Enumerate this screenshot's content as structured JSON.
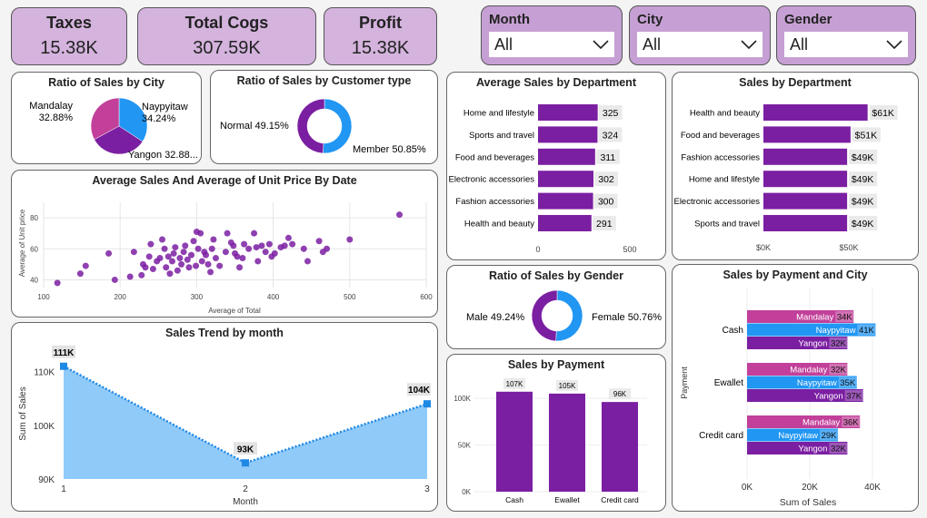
{
  "kpis": {
    "taxes": {
      "title": "Taxes",
      "value": "15.38K"
    },
    "cogs": {
      "title": "Total Cogs",
      "value": "307.59K"
    },
    "profit": {
      "title": "Profit",
      "value": "15.38K"
    }
  },
  "slicers": {
    "month": {
      "title": "Month",
      "value": "All"
    },
    "city": {
      "title": "City",
      "value": "All"
    },
    "gender": {
      "title": "Gender",
      "value": "All"
    }
  },
  "colors": {
    "purple": "#7b1fa2",
    "blue": "#2196f3",
    "pink": "#c2409a",
    "area": "#90caf9",
    "kpi": "#d4b3dd"
  },
  "chart_data": [
    {
      "id": "city_pie",
      "type": "pie",
      "title": "Ratio of Sales by City",
      "slices": [
        {
          "label": "Naypyitaw",
          "text": "34.24%",
          "value": 34.24,
          "color": "#2196f3"
        },
        {
          "label": "Yangon",
          "text": "32.88...",
          "value": 32.88,
          "color": "#7b1fa2"
        },
        {
          "label": "Mandalay",
          "text": "32.88%",
          "value": 32.88,
          "color": "#c2409a"
        }
      ]
    },
    {
      "id": "customer_donut",
      "type": "pie",
      "title": "Ratio of Sales by Customer type",
      "slices": [
        {
          "label": "Member",
          "text": "50.85%",
          "value": 50.85,
          "color": "#2196f3"
        },
        {
          "label": "Normal",
          "text": "49.15%",
          "value": 49.15,
          "color": "#7b1fa2"
        }
      ]
    },
    {
      "id": "scatter",
      "type": "scatter",
      "title": "Average Sales And Average of Unit Price By Date",
      "xlabel": "Average of Total",
      "ylabel": "Average of Unit price",
      "xlim": [
        100,
        600
      ],
      "ylim": [
        35,
        90
      ],
      "xticks": [
        100,
        200,
        300,
        400,
        500,
        600
      ],
      "yticks": [
        40,
        60,
        80
      ],
      "points": [
        [
          118,
          38
        ],
        [
          148,
          44
        ],
        [
          155,
          49
        ],
        [
          185,
          57
        ],
        [
          193,
          40
        ],
        [
          213,
          42
        ],
        [
          218,
          58
        ],
        [
          228,
          43
        ],
        [
          230,
          50
        ],
        [
          233,
          48
        ],
        [
          238,
          55
        ],
        [
          240,
          63
        ],
        [
          243,
          47
        ],
        [
          248,
          52
        ],
        [
          252,
          54
        ],
        [
          255,
          66
        ],
        [
          258,
          60
        ],
        [
          260,
          48
        ],
        [
          263,
          55
        ],
        [
          265,
          44
        ],
        [
          268,
          52
        ],
        [
          270,
          57
        ],
        [
          272,
          61
        ],
        [
          275,
          46
        ],
        [
          278,
          54
        ],
        [
          280,
          50
        ],
        [
          283,
          58
        ],
        [
          285,
          62
        ],
        [
          288,
          53
        ],
        [
          290,
          48
        ],
        [
          293,
          56
        ],
        [
          296,
          65
        ],
        [
          299,
          49
        ],
        [
          300,
          71
        ],
        [
          302,
          60
        ],
        [
          305,
          70
        ],
        [
          307,
          52
        ],
        [
          310,
          58
        ],
        [
          312,
          56
        ],
        [
          315,
          50
        ],
        [
          318,
          45
        ],
        [
          320,
          60
        ],
        [
          322,
          66
        ],
        [
          325,
          54
        ],
        [
          330,
          49
        ],
        [
          338,
          58
        ],
        [
          340,
          70
        ],
        [
          345,
          64
        ],
        [
          348,
          62
        ],
        [
          350,
          57
        ],
        [
          353,
          55
        ],
        [
          356,
          48
        ],
        [
          360,
          54
        ],
        [
          362,
          63
        ],
        [
          368,
          60
        ],
        [
          375,
          70
        ],
        [
          378,
          61
        ],
        [
          380,
          52
        ],
        [
          385,
          62
        ],
        [
          390,
          58
        ],
        [
          395,
          63
        ],
        [
          398,
          55
        ],
        [
          402,
          57
        ],
        [
          410,
          61
        ],
        [
          415,
          62
        ],
        [
          420,
          67
        ],
        [
          425,
          63
        ],
        [
          440,
          60
        ],
        [
          445,
          52
        ],
        [
          460,
          65
        ],
        [
          465,
          58
        ],
        [
          470,
          60
        ],
        [
          500,
          66
        ],
        [
          565,
          82
        ]
      ]
    },
    {
      "id": "trend",
      "type": "area",
      "title": "Sales Trend by month",
      "xlabel": "Month",
      "ylabel": "Sum of Sales",
      "x": [
        1,
        2,
        3
      ],
      "values": [
        111,
        93,
        104
      ],
      "labels": [
        "111K",
        "93K",
        "104K"
      ],
      "ylim": [
        90,
        114
      ],
      "yticks": [
        90,
        100,
        110
      ],
      "ytick_labels": [
        "90K",
        "100K",
        "110K"
      ]
    },
    {
      "id": "avg_dept",
      "type": "bar",
      "title": "Average Sales by Department",
      "categories": [
        "Home and lifestyle",
        "Sports and travel",
        "Food and beverages",
        "Electronic accessories",
        "Fashion accessories",
        "Health and beauty"
      ],
      "values": [
        325,
        324,
        311,
        302,
        300,
        291
      ],
      "xlim": [
        0,
        500
      ],
      "xticks": [
        "0",
        "500"
      ]
    },
    {
      "id": "sales_dept",
      "type": "bar",
      "title": "Sales by Department",
      "categories": [
        "Health and beauty",
        "Food and beverages",
        "Fashion accessories",
        "Home and lifestyle",
        "Electronic accessories",
        "Sports and travel"
      ],
      "values": [
        61,
        51,
        49,
        49,
        49,
        49
      ],
      "labels": [
        "$61K",
        "$51K",
        "$49K",
        "$49K",
        "$49K",
        "$49K"
      ],
      "xlim": [
        0,
        70
      ],
      "xticks": [
        "$0K",
        "$50K"
      ]
    },
    {
      "id": "gender_donut",
      "type": "pie",
      "title": "Ratio of Sales by Gender",
      "slices": [
        {
          "label": "Female",
          "text": "50.76%",
          "value": 50.76,
          "color": "#2196f3"
        },
        {
          "label": "Male",
          "text": "49.24%",
          "value": 49.24,
          "color": "#7b1fa2"
        }
      ]
    },
    {
      "id": "payment",
      "type": "bar",
      "title": "Sales by Payment",
      "categories": [
        "Cash",
        "Ewallet",
        "Credit card"
      ],
      "values": [
        107,
        105,
        96
      ],
      "labels": [
        "107K",
        "105K",
        "96K"
      ],
      "ylim": [
        0,
        110
      ],
      "yticks": [
        "0K",
        "50K",
        "100K"
      ]
    },
    {
      "id": "pay_city",
      "type": "bar",
      "title": "Sales by Payment and City",
      "xlabel": "Sum of Sales",
      "ylabel": "Payment",
      "groups": [
        {
          "name": "Cash",
          "bars": [
            {
              "city": "Mandalay",
              "value": 34,
              "label": "34K"
            },
            {
              "city": "Naypyitaw",
              "value": 41,
              "label": "41K"
            },
            {
              "city": "Yangon",
              "value": 32,
              "label": "32K"
            }
          ]
        },
        {
          "name": "Ewallet",
          "bars": [
            {
              "city": "Mandalay",
              "value": 32,
              "label": "32K"
            },
            {
              "city": "Naypyitaw",
              "value": 35,
              "label": "35K"
            },
            {
              "city": "Yangon",
              "value": 37,
              "label": "37K"
            }
          ]
        },
        {
          "name": "Credit card",
          "bars": [
            {
              "city": "Mandalay",
              "value": 36,
              "label": "36K"
            },
            {
              "city": "Naypyitaw",
              "value": 29,
              "label": "29K"
            },
            {
              "city": "Yangon",
              "value": 32,
              "label": "32K"
            }
          ]
        }
      ],
      "xlim": [
        0,
        45
      ],
      "xticks": [
        "0K",
        "20K",
        "40K"
      ]
    }
  ]
}
